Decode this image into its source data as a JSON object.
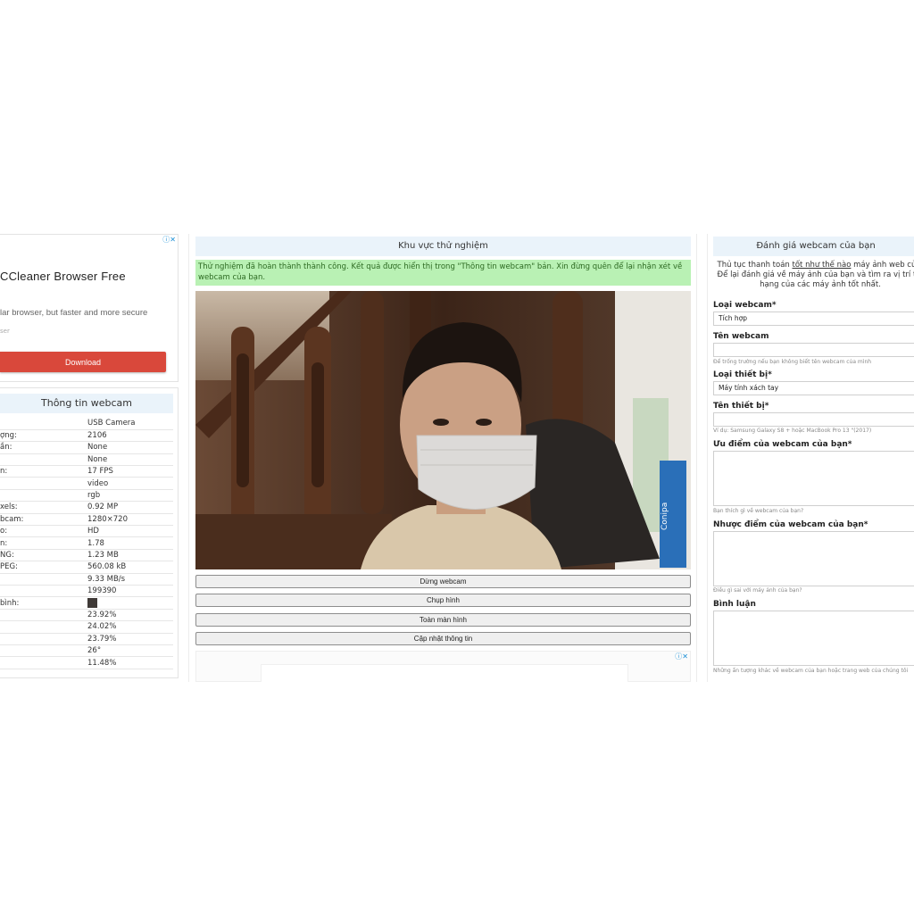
{
  "ad": {
    "choices_icon": "adchoices-icon",
    "title": "CCleaner Browser Free",
    "text": "lar browser, but faster and more secure",
    "small": "ser",
    "download_label": "Download",
    "button_color": "#d9483b"
  },
  "info": {
    "title": "Thông tin webcam",
    "rows": [
      {
        "k": "",
        "v": "USB Camera"
      },
      {
        "k": "ợng:",
        "v": "2106"
      },
      {
        "k": "ần:",
        "v": "None"
      },
      {
        "k": "",
        "v": "None"
      },
      {
        "k": "n:",
        "v": "17 FPS"
      },
      {
        "k": "",
        "v": "video"
      },
      {
        "k": "",
        "v": "rgb"
      },
      {
        "k": "xels:",
        "v": "0.92 MP"
      },
      {
        "k": "bcam:",
        "v": "1280×720"
      },
      {
        "k": "o:",
        "v": "HD"
      },
      {
        "k": "n:",
        "v": "1.78"
      },
      {
        "k": "NG:",
        "v": "1.23 MB"
      },
      {
        "k": "PEG:",
        "v": "560.08 kB"
      },
      {
        "k": "",
        "v": "9.33 MB/s"
      },
      {
        "k": "",
        "v": "199390"
      },
      {
        "k": "bình:",
        "v": "",
        "swatch": "#3f3a37"
      },
      {
        "k": "",
        "v": "23.92%"
      },
      {
        "k": "",
        "v": "24.02%"
      },
      {
        "k": "",
        "v": "23.79%"
      },
      {
        "k": "",
        "v": "26°"
      },
      {
        "k": "",
        "v": "11.48%"
      }
    ]
  },
  "center": {
    "title": "Khu vực thử nghiệm",
    "success": "Thử nghiệm đã hoàn thành thành công. Kết quả được hiển thị trong \"Thông tin webcam\" bản. Xin đừng quên để lại nhận xét về webcam của bạn.",
    "buttons": {
      "stop": "Dừng webcam",
      "capture": "Chụp hình",
      "fullscreen": "Toàn màn hình",
      "update": "Cập nhật thông tin"
    },
    "mask_brand": "Conipa"
  },
  "review": {
    "title": "Đánh giá webcam của bạn",
    "intro_pre": "Thủ tục thanh toán ",
    "intro_link": "tốt như thế nào",
    "intro_post": " máy ảnh web củ... Để lại đánh giá về máy ảnh của bạn và tìm ra vị trí t... hạng của các máy ảnh tốt nhất.",
    "webcam_type_label": "Loại webcam*",
    "webcam_type_value": "Tích hợp",
    "webcam_name_label": "Tên webcam",
    "webcam_name_hint": "Để trống trường nếu bạn không biết tên webcam của mình",
    "device_type_label": "Loại thiết bị*",
    "device_type_value": "Máy tính xách tay",
    "device_name_label": "Tên thiết bị*",
    "device_name_hint": "Ví dụ: Samsung Galaxy S8 + hoặc MacBook Pro 13 \"(2017)",
    "pros_label": "Ưu điểm của webcam của bạn*",
    "pros_hint": "Bạn thích gì về webcam của bạn?",
    "cons_label": "Nhược điểm của webcam của bạn*",
    "cons_hint": "Điều gì sai với máy ảnh của bạn?",
    "comment_label": "Bình luận",
    "comment_hint": "Những ấn tượng khác về webcam của bạn hoặc trang web của chúng tôi"
  }
}
